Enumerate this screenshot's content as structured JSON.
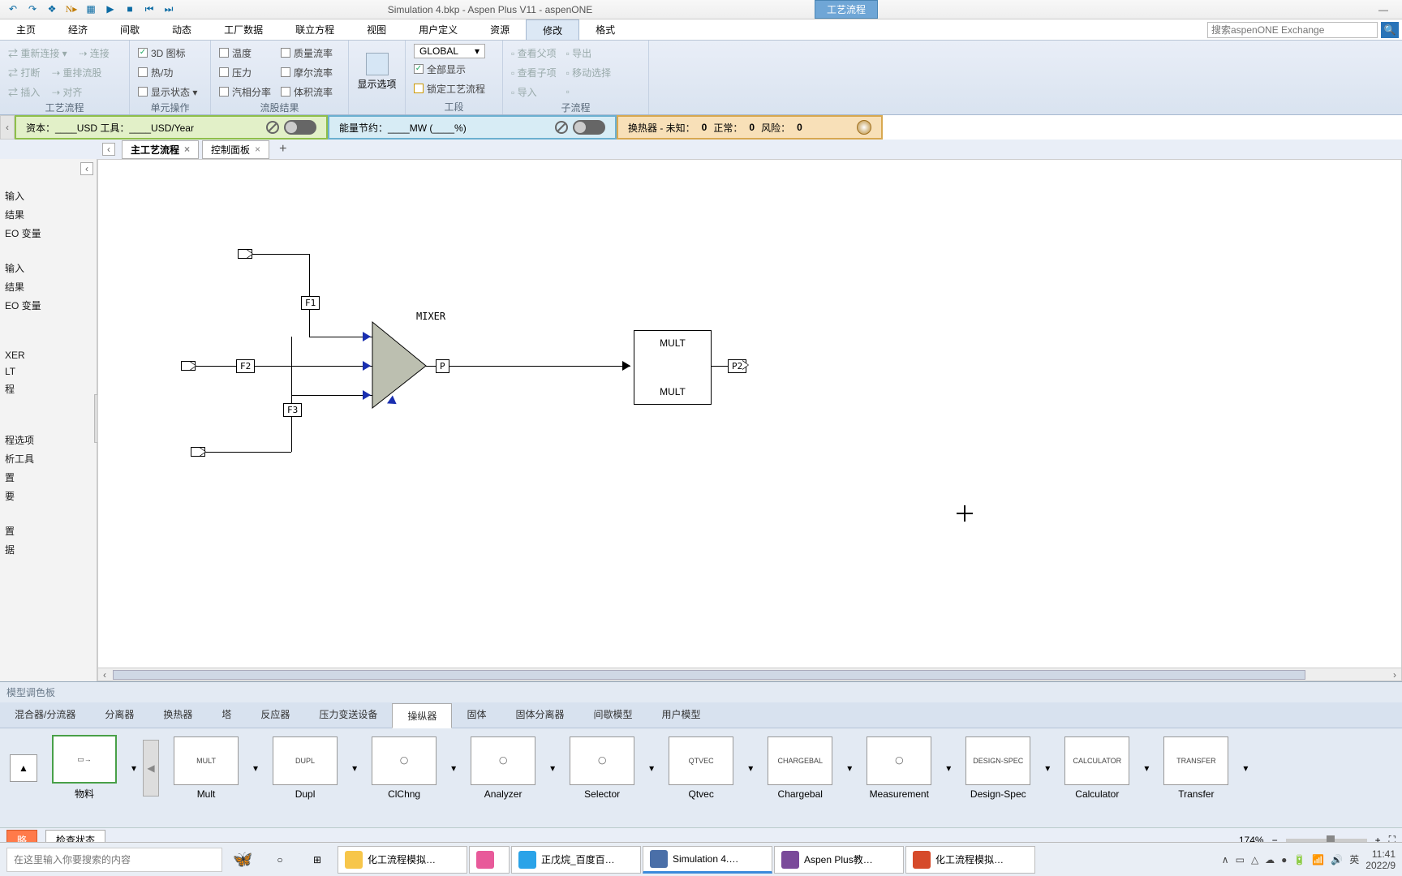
{
  "qat_icons": [
    "undo-icon",
    "redo-icon",
    "file-icon",
    "nav-icon",
    "run-icon",
    "next-icon",
    "stop-icon",
    "rewind-icon",
    "step-icon"
  ],
  "title": "Simulation 4.bkp - Aspen Plus V11 - aspenONE",
  "title_tab": "工艺流程",
  "menu_tabs": [
    "主页",
    "经济",
    "间歇",
    "动态",
    "工厂数据",
    "联立方程",
    "视图",
    "用户定义",
    "资源",
    "修改",
    "格式"
  ],
  "menu_active_index": 9,
  "search_placeholder": "搜索aspenONE Exchange",
  "ribbon": {
    "g1": {
      "items": [
        [
          "重新连接 ▾",
          "连接"
        ],
        [
          "打断",
          "重排流股"
        ],
        [
          "插入",
          "对齐"
        ]
      ],
      "label": "工艺流程"
    },
    "g2": {
      "items": [
        "3D 图标",
        "热/功",
        "显示状态 ▾"
      ],
      "label": "单元操作"
    },
    "g3": {
      "items": [
        [
          "温度",
          "质量流率"
        ],
        [
          "压力",
          "摩尔流率"
        ],
        [
          "汽相分率",
          "体积流率"
        ]
      ],
      "label": "流股结果"
    },
    "g4": {
      "btn": "显示选项",
      "label": ""
    },
    "g5": {
      "scope": "GLOBAL",
      "cb1": "全部显示",
      "cb2": "锁定工艺流程",
      "label": "工段"
    },
    "g6": {
      "items": [
        [
          "查看父项",
          "导出"
        ],
        [
          "查看子项",
          "移动选择"
        ],
        [
          "导入",
          ""
        ]
      ],
      "label": "子流程"
    }
  },
  "greenbar": {
    "t1": "资本：____USD  工具：____USD/Year"
  },
  "bluebar": {
    "t1": "能量节约：____MW   (____%)"
  },
  "orangebar": {
    "t1": "换热器 - 未知：",
    "v1": "0",
    "t2": "正常：",
    "v2": "0",
    "t3": "风险：",
    "v3": "0"
  },
  "doctabs": [
    {
      "label": "主工艺流程",
      "active": true
    },
    {
      "label": "控制面板",
      "active": false
    }
  ],
  "sidebar": [
    "输入",
    "结果",
    "EO 变量",
    "",
    "输入",
    "结果",
    "EO 变量",
    "",
    "",
    "XER",
    "LT",
    "程",
    "",
    "",
    "程选项",
    "析工具",
    "置",
    "要",
    "",
    "置",
    "据"
  ],
  "flow": {
    "mixer": "MIXER",
    "F1": "F1",
    "F2": "F2",
    "F3": "F3",
    "P": "P",
    "P2": "P2",
    "mult1": "MULT",
    "mult2": "MULT"
  },
  "palette": {
    "title": "模型调色板",
    "tabs": [
      "混合器/分流器",
      "分离器",
      "换热器",
      "塔",
      "反应器",
      "压力变送设备",
      "操纵器",
      "固体",
      "固体分离器",
      "间歇模型",
      "用户模型"
    ],
    "active_index": 6,
    "first": "物料",
    "items": [
      "Mult",
      "Dupl",
      "ClChng",
      "Analyzer",
      "Selector",
      "Qtvec",
      "Chargebal",
      "Measurement",
      "Design-Spec",
      "Calculator",
      "Transfer"
    ],
    "small": [
      "MULT",
      "DUPL",
      "",
      "",
      "",
      "QTVEC",
      "CHARGEBAL",
      "",
      "DESIGN-SPEC",
      "CALCULATOR",
      "TRANSFER"
    ]
  },
  "status": {
    "btn1": "略",
    "btn2": "检查状态",
    "zoom": "174%"
  },
  "taskbar": {
    "search": "在这里输入你要搜索的内容",
    "apps": [
      {
        "label": "化工流程模拟…",
        "active": false,
        "color": "#f7c64a"
      },
      {
        "label": "",
        "active": false,
        "color": "#e85a9a",
        "icon_only": true
      },
      {
        "label": "正戊烷_百度百…",
        "active": false,
        "color": "#2aa3e8"
      },
      {
        "label": "Simulation 4.…",
        "active": true,
        "color": "#4a6fa8"
      },
      {
        "label": "Aspen Plus教…",
        "active": false,
        "color": "#7a4a9a"
      },
      {
        "label": "化工流程模拟…",
        "active": false,
        "color": "#d64a2a"
      }
    ],
    "tray": [
      "∧",
      "▭",
      "△",
      "☁",
      "●",
      "🔋",
      "📶",
      "🔊",
      "英"
    ],
    "time": "11:41",
    "date": "2022/9"
  }
}
